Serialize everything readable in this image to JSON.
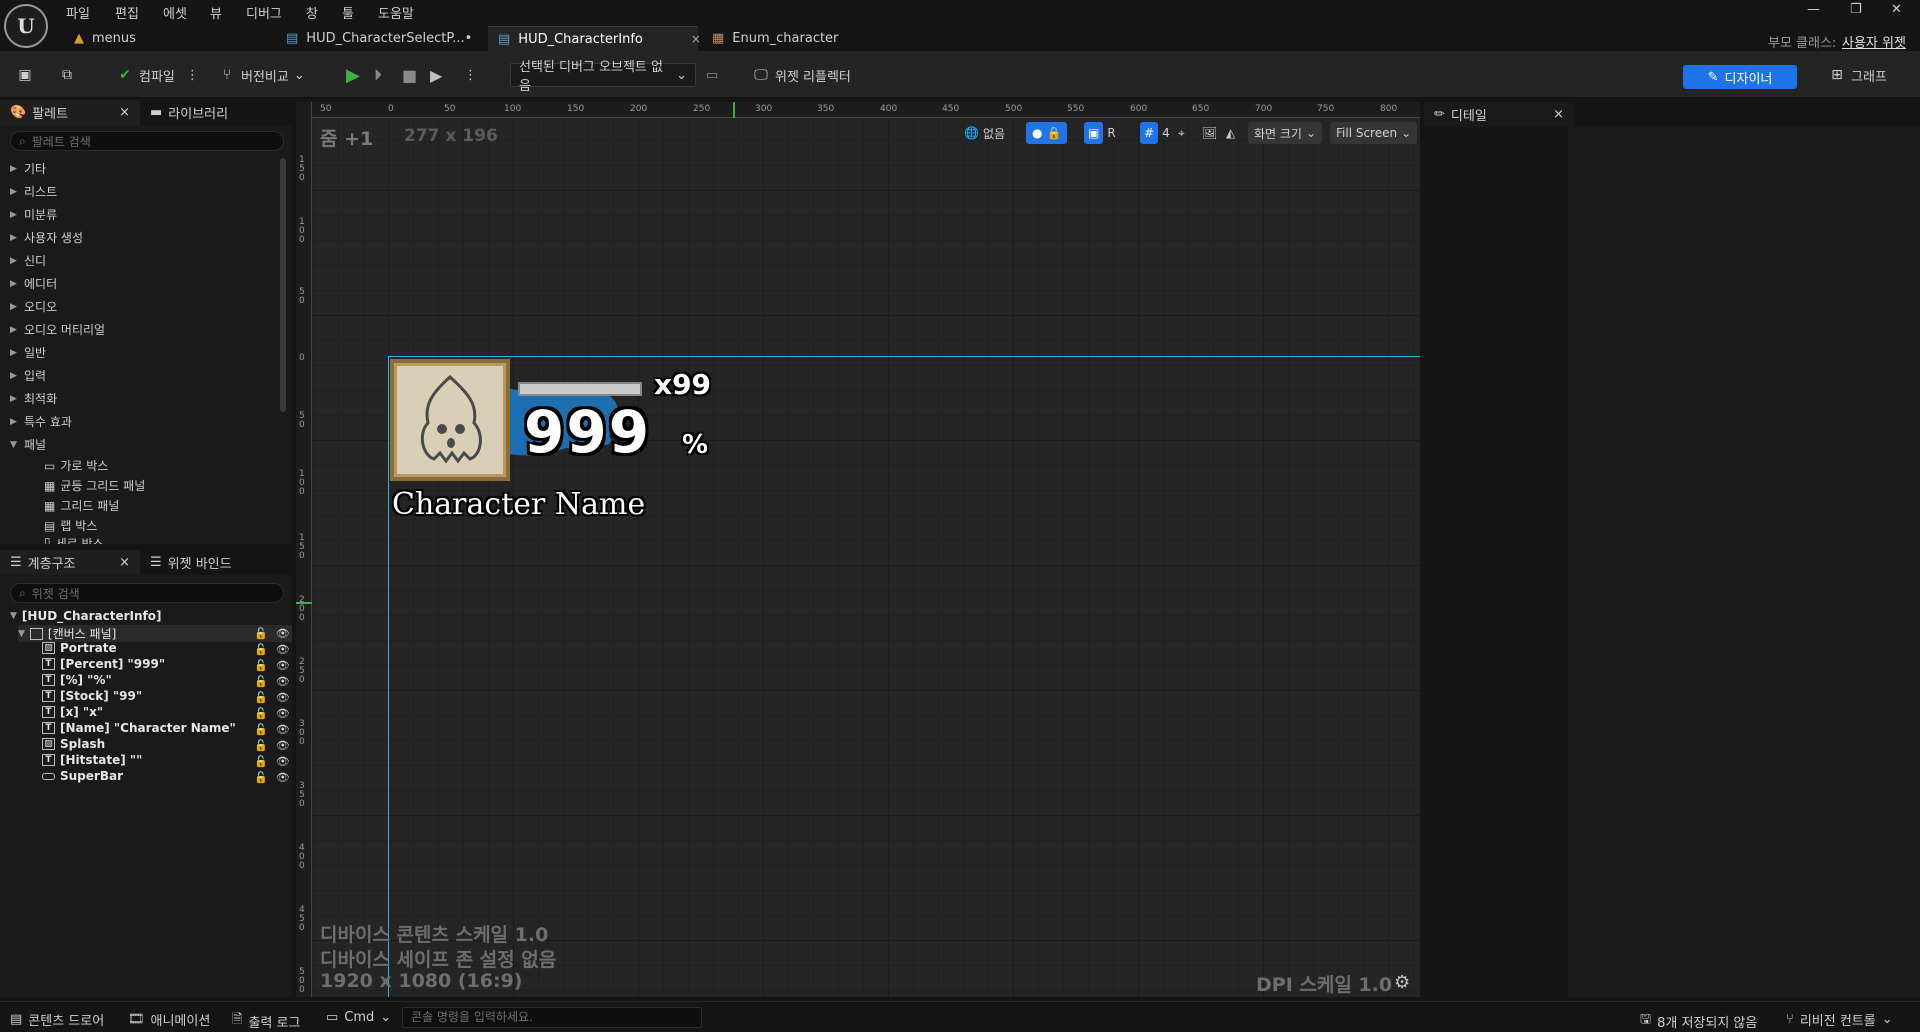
{
  "menu": [
    "파일",
    "편집",
    "에셋",
    "뷰",
    "디버그",
    "창",
    "툴",
    "도움말"
  ],
  "tabs": [
    {
      "label": "menus"
    },
    {
      "label": "HUD_CharacterSelectP...•"
    },
    {
      "label": "HUD_CharacterInfo",
      "close": "×"
    },
    {
      "label": "Enum_character"
    }
  ],
  "parent_class": {
    "label": "부모 클래스:",
    "value": "사용자 위젯"
  },
  "toolbar": {
    "compile": "컴파일",
    "diff": "버전비교",
    "debug_object": "선택된 디버그 오브젝트 없음",
    "widget_reflector": "위젯 리플렉터",
    "designer": "디자이너",
    "graph": "그래프"
  },
  "palette": {
    "tab": "팔레트",
    "library_tab": "라이브러리",
    "search_placeholder": "팔레트 검색",
    "categories": [
      "기타",
      "리스트",
      "미분류",
      "사용자 생성",
      "신디",
      "에디터",
      "오디오",
      "오디오 머티리얼",
      "일반",
      "입력",
      "최적화",
      "특수 효과",
      "패널"
    ],
    "panel_items": [
      "가로 박스",
      "균등 그리드 패널",
      "그리드 패널",
      "랩 박스",
      "세로 박스"
    ]
  },
  "hierarchy": {
    "tab": "계층구조",
    "binding_tab": "위젯 바인드",
    "search_placeholder": "위젯 검색",
    "root": "[HUD_CharacterInfo]",
    "canvas": "[캔버스 패널]",
    "items": [
      {
        "label": "Portrate",
        "icon": "img"
      },
      {
        "label": "[Percent] \"999\"",
        "icon": "T"
      },
      {
        "label": "[%] \"%\"",
        "icon": "T"
      },
      {
        "label": "[Stock] \"99\"",
        "icon": "T"
      },
      {
        "label": "[x] \"x\"",
        "icon": "T"
      },
      {
        "label": "[Name] \"Character Name\"",
        "icon": "T"
      },
      {
        "label": "Splash",
        "icon": "img"
      },
      {
        "label": "[Hitstate] \"\"",
        "icon": "T"
      },
      {
        "label": "SuperBar",
        "icon": "bar"
      }
    ]
  },
  "viewport": {
    "zoom": "줌 +1",
    "size": "277 x 196",
    "none_label": "없음",
    "grid_num": "4",
    "screen_size": "화면 크기",
    "fill_screen": "Fill Screen",
    "r_label": "R",
    "device_scale": "디바이스 콘텐츠 스케일 1.0",
    "safe_zone": "디바이스 세이프 존 설정 없음",
    "resolution": "1920 x 1080 (16:9)",
    "dpi": "DPI 스케일 1.0",
    "ruler_top": [
      "50",
      "0",
      "50",
      "100",
      "150",
      "200",
      "250",
      "300",
      "350",
      "400",
      "450",
      "500",
      "550",
      "600",
      "650",
      "700",
      "750",
      "800"
    ],
    "ruler_left": [
      "150",
      "100",
      "50",
      "0",
      "50",
      "100",
      "150",
      "200",
      "250",
      "300",
      "350",
      "400",
      "450",
      "500"
    ]
  },
  "hud": {
    "stock_prefix": "x",
    "stock": "99",
    "percent": "999",
    "percent_sign": "%",
    "name": "Character Name",
    "splash_color": "#1e6fb0"
  },
  "details": {
    "tab": "디테일"
  },
  "bottombar": {
    "content_drawer": "콘텐츠 드로어",
    "animation": "애니메이션",
    "output_log": "출력 로그",
    "cmd": "Cmd",
    "console_placeholder": "콘솔 명령을 입력하세요.",
    "unsaved": "8개 저장되지 않음",
    "revision": "리비전 컨트롤"
  },
  "colors": {
    "accent": "#1f74ea",
    "play_green": "#3cb043",
    "guide_cyan": "#29b6d8"
  }
}
